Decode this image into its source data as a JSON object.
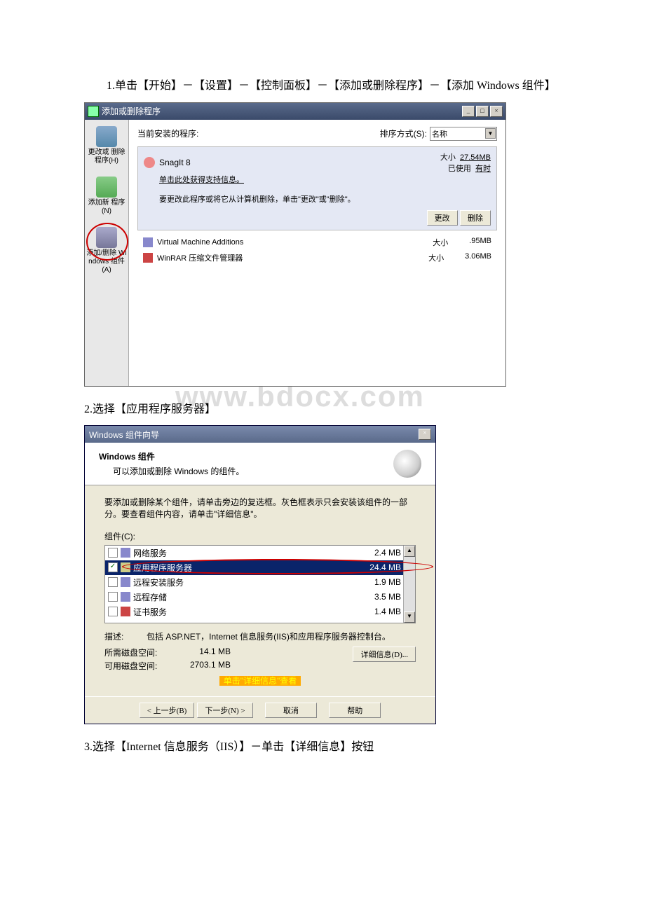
{
  "steps": {
    "s1": "1.单击【开始】－【设置】－【控制面板】－【添加或删除程序】－【添加 Windows 组件】",
    "s2": "2.选择【应用程序服务器】",
    "s3": "3.选择【Internet 信息服务（IIS）】－单击【详细信息】按钮"
  },
  "watermark": "www.bdocx.com",
  "win1": {
    "title": "添加或删除程序",
    "current_label": "当前安装的程序:",
    "sort_label": "排序方式(S):",
    "sort_value": "名称",
    "sidebar": {
      "i1": "更改或\n删除\n程序(H)",
      "i2": "添加新\n程序(N)",
      "i3": "添加/删除\nWindows\n组件(A)"
    },
    "prog1": {
      "name": "SnagIt 8",
      "link": "单击此处获得支持信息。",
      "size_lbl": "大小",
      "size_val": "27.54MB",
      "used_lbl": "已使用",
      "used_val": "有时",
      "desc": "要更改此程序或将它从计算机删除，单击\"更改\"或\"删除\"。",
      "btn_change": "更改",
      "btn_remove": "删除"
    },
    "prog2": {
      "name": "Virtual Machine Additions",
      "size_lbl": "大小",
      "size_val": ".95MB"
    },
    "prog3": {
      "name": "WinRAR 压缩文件管理器",
      "size_lbl": "大小",
      "size_val": "3.06MB"
    }
  },
  "win2": {
    "title": "Windows 组件向导",
    "head_title": "Windows 组件",
    "head_sub": "可以添加或删除 Windows 的组件。",
    "hint": "要添加或删除某个组件，请单击旁边的复选框。灰色框表示只会安装该组件的一部分。要查看组件内容，请单击\"详细信息\"。",
    "list_label": "组件(C):",
    "items": {
      "i1": {
        "name": "网络服务",
        "size": "2.4 MB"
      },
      "i2": {
        "name": "应用程序服务器",
        "size": "24.4 MB"
      },
      "i3": {
        "name": "远程安装服务",
        "size": "1.9 MB"
      },
      "i4": {
        "name": "远程存储",
        "size": "3.5 MB"
      },
      "i5": {
        "name": "证书服务",
        "size": "1.4 MB"
      }
    },
    "desc_label": "描述:",
    "desc_text": "包括 ASP.NET，Internet 信息服务(IIS)和应用程序服务器控制台。",
    "req_label": "所需磁盘空间:",
    "req_val": "14.1 MB",
    "avail_label": "可用磁盘空间:",
    "avail_val": "2703.1 MB",
    "detail_btn": "详细信息(D)...",
    "orange": "单击\"详细信息\"查看",
    "btn_back": "< 上一步(B)",
    "btn_next": "下一步(N) >",
    "btn_cancel": "取消",
    "btn_help": "帮助"
  }
}
